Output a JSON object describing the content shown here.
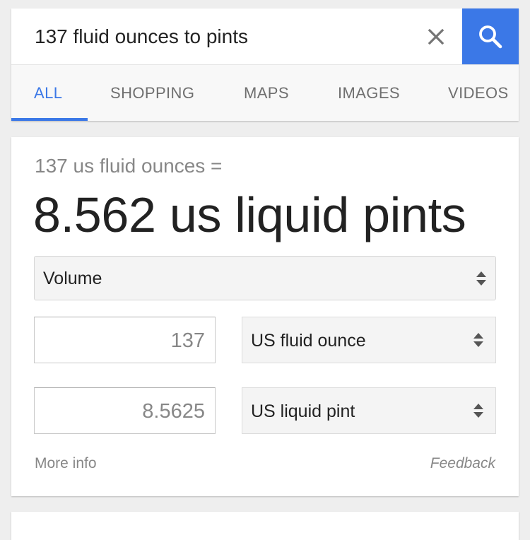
{
  "search": {
    "query": "137 fluid ounces to pints",
    "clear_icon": "close-icon",
    "search_icon": "search-icon",
    "accent_color": "#3b78e7"
  },
  "tabs": [
    {
      "label": "ALL",
      "active": true
    },
    {
      "label": "SHOPPING",
      "active": false
    },
    {
      "label": "MAPS",
      "active": false
    },
    {
      "label": "IMAGES",
      "active": false
    },
    {
      "label": "VIDEOS",
      "active": false
    }
  ],
  "converter": {
    "from_text": "137 us fluid ounces =",
    "result_text": "8.562 us liquid pints",
    "category": "Volume",
    "input_value": "137",
    "input_unit": "US fluid ounce",
    "output_value": "8.5625",
    "output_unit": "US liquid pint",
    "more_info": "More info",
    "feedback": "Feedback"
  }
}
